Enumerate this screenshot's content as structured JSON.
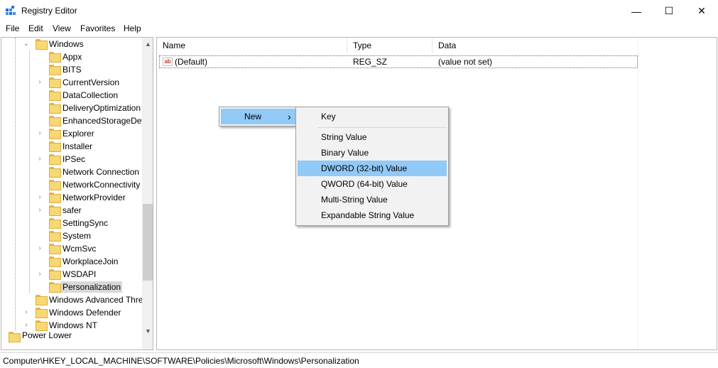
{
  "window": {
    "title": "Registry Editor",
    "minimize_glyph": "—",
    "maximize_glyph": "☐",
    "close_glyph": "✕",
    "app_icon": "registry-icon"
  },
  "menubar": {
    "items": [
      "File",
      "Edit",
      "View",
      "Favorites",
      "Help"
    ]
  },
  "tree": {
    "parent_label": "Windows",
    "children": [
      {
        "label": "Appx",
        "expandable": false
      },
      {
        "label": "BITS",
        "expandable": false
      },
      {
        "label": "CurrentVersion",
        "expandable": true
      },
      {
        "label": "DataCollection",
        "expandable": false
      },
      {
        "label": "DeliveryOptimization",
        "expandable": false
      },
      {
        "label": "EnhancedStorageDev",
        "expandable": false
      },
      {
        "label": "Explorer",
        "expandable": true
      },
      {
        "label": "Installer",
        "expandable": false
      },
      {
        "label": "IPSec",
        "expandable": true
      },
      {
        "label": "Network Connection",
        "expandable": false
      },
      {
        "label": "NetworkConnectivity",
        "expandable": false
      },
      {
        "label": "NetworkProvider",
        "expandable": true
      },
      {
        "label": "safer",
        "expandable": true
      },
      {
        "label": "SettingSync",
        "expandable": false
      },
      {
        "label": "System",
        "expandable": false
      },
      {
        "label": "WcmSvc",
        "expandable": true
      },
      {
        "label": "WorkplaceJoin",
        "expandable": false
      },
      {
        "label": "WSDAPI",
        "expandable": true
      },
      {
        "label": "Personalization",
        "expandable": false,
        "selected": true
      }
    ],
    "siblings": [
      {
        "label": "Windows Advanced Thre",
        "expandable": false
      },
      {
        "label": "Windows Defender",
        "expandable": true
      },
      {
        "label": "Windows NT",
        "expandable": true
      }
    ],
    "cut_off_label": "Power Lower"
  },
  "list": {
    "columns": {
      "name": "Name",
      "type": "Type",
      "data": "Data"
    },
    "rows": [
      {
        "name": "(Default)",
        "type": "REG_SZ",
        "data": "(value not set)",
        "icon": "string-value-icon"
      }
    ]
  },
  "context_menu": {
    "new_label": "New",
    "arrow": "›"
  },
  "submenu": {
    "key_label": "Key",
    "items": [
      "String Value",
      "Binary Value",
      "DWORD (32-bit) Value",
      "QWORD (64-bit) Value",
      "Multi-String Value",
      "Expandable String Value"
    ],
    "highlighted": "DWORD (32-bit) Value"
  },
  "status": {
    "path": "Computer\\HKEY_LOCAL_MACHINE\\SOFTWARE\\Policies\\Microsoft\\Windows\\Personalization"
  },
  "colors": {
    "menu_highlight": "#91c9f7",
    "folder": "#f8d775",
    "selected_tree": "#d9d9d9"
  }
}
